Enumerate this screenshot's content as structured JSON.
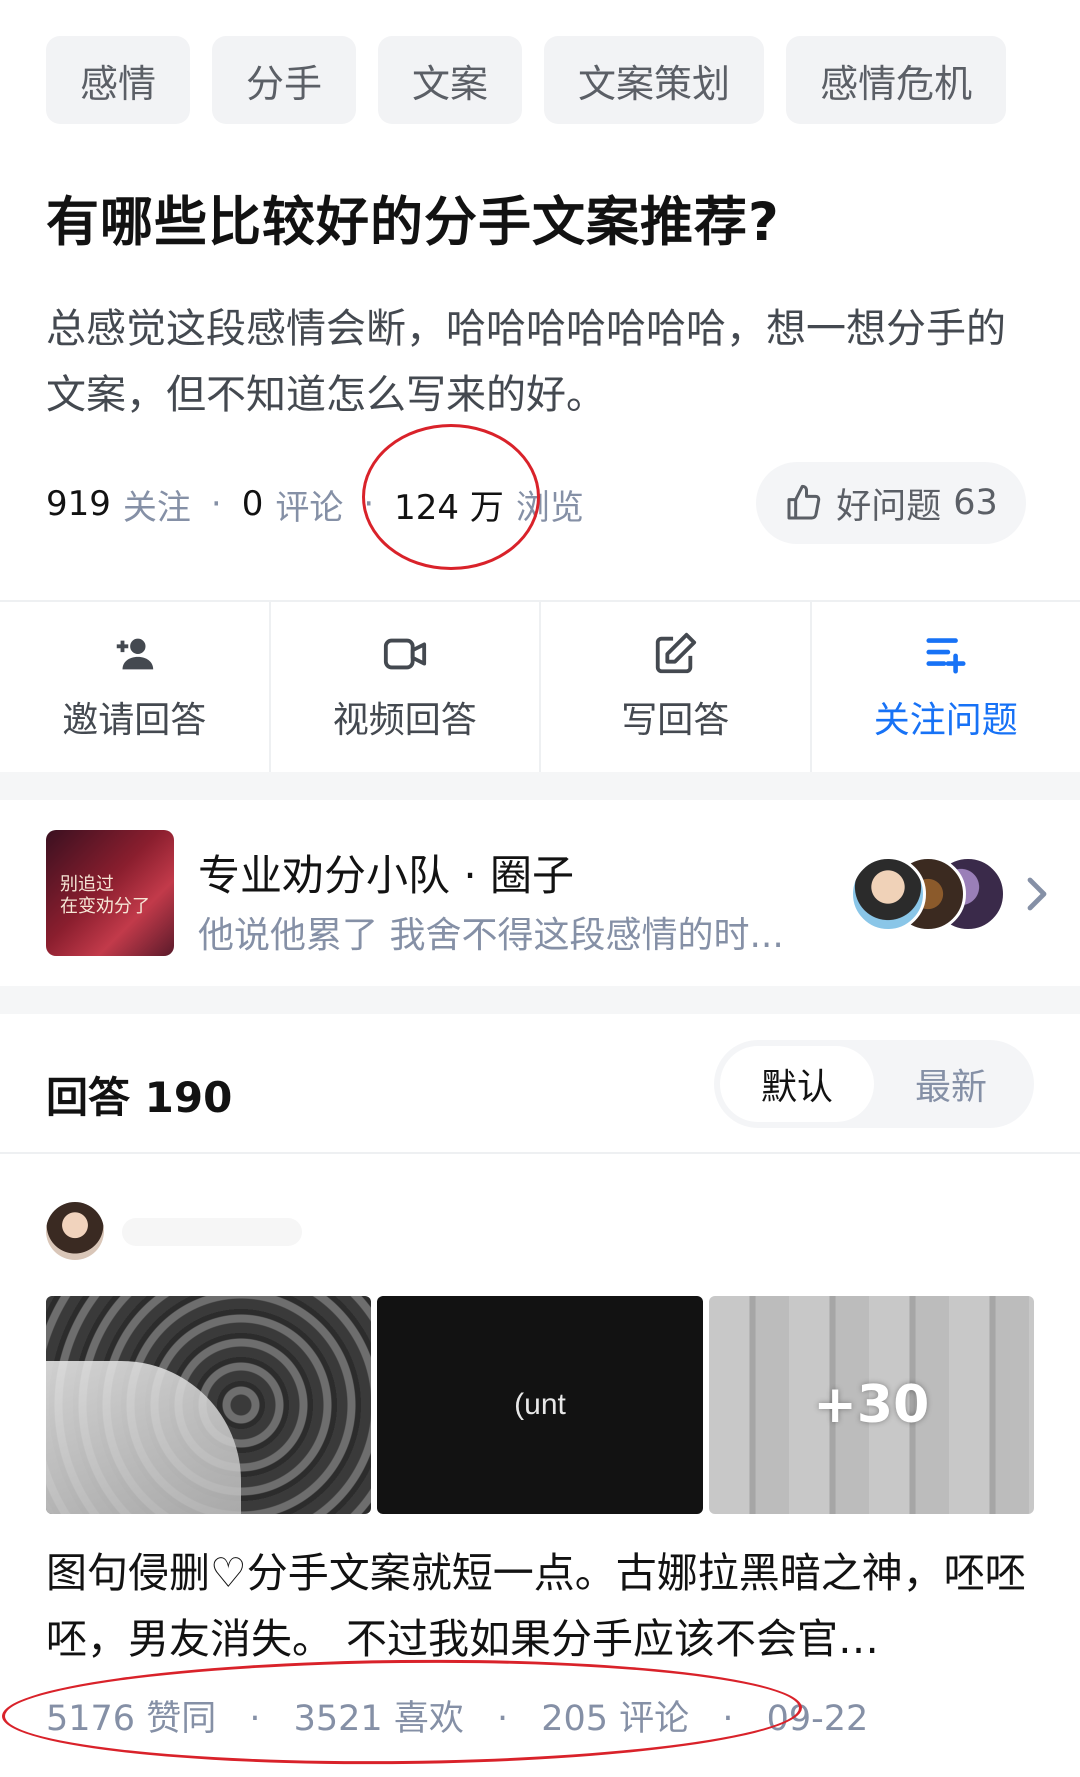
{
  "tags": [
    "感情",
    "分手",
    "文案",
    "文案策划",
    "感情危机"
  ],
  "question": {
    "title": "有哪些比较好的分手文案推荐?",
    "description": "总感觉这段感情会断，哈哈哈哈哈哈哈，想一想分手的文案，但不知道怎么写来的好。",
    "stats": {
      "follow_count": "919",
      "follow_label": "关注",
      "comment_count": "0",
      "comment_label": "评论",
      "view_count": "124 万",
      "view_label": "浏览"
    },
    "good_question": {
      "label": "好问题",
      "count": "63"
    }
  },
  "actions": [
    {
      "label": "邀请回答",
      "icon": "invite-user-icon"
    },
    {
      "label": "视频回答",
      "icon": "video-camera-icon"
    },
    {
      "label": "写回答",
      "icon": "edit-icon"
    },
    {
      "label": "关注问题",
      "icon": "follow-list-icon",
      "active": true
    }
  ],
  "circle": {
    "thumb_text": "别追过\n在变劝分了",
    "title": "专业劝分小队 · 圈子",
    "subtitle": "他说他累了 我舍不得这段感情的时..."
  },
  "answers_header": {
    "label": "回答 190",
    "sort": {
      "default": "默认",
      "latest": "最新"
    }
  },
  "answer": {
    "image_overlay": "+30",
    "image2_text": "(unt",
    "text": "图句侵删♡分手文案就短一点。古娜拉黑暗之神，呸呸呸，男友消失。 不过我如果分手应该不会官…",
    "meta": {
      "likes": "5176 赞同",
      "favorites": "3521 喜欢",
      "comments": "205 评论",
      "date": "09-22"
    }
  },
  "colors": {
    "accent_blue": "#1772f6",
    "annotation_red": "#d9222a",
    "secondary_text": "#8590a6"
  }
}
